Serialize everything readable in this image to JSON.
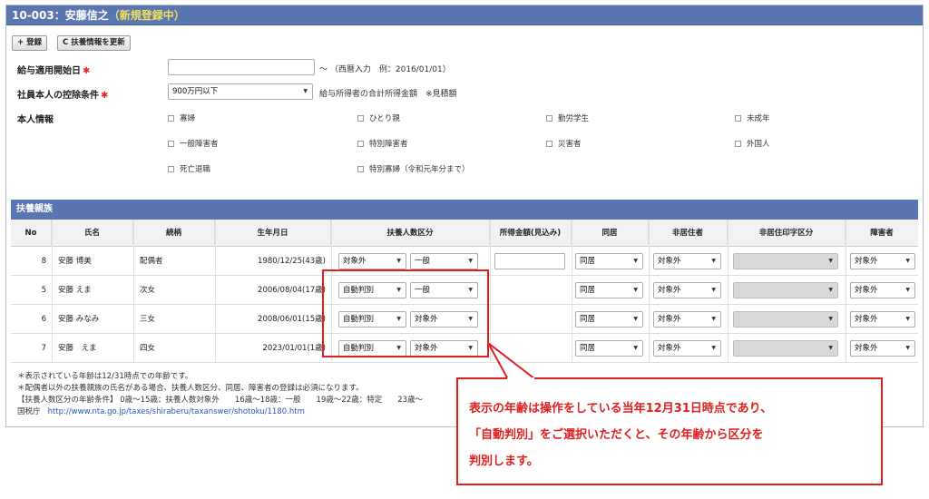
{
  "header": {
    "title": "10-003：安藤信之",
    "status": "（新規登録中）"
  },
  "toolbar": {
    "register_label": "登録",
    "register_icon": "+",
    "refresh_label": "扶養情報を更新",
    "refresh_icon": "C"
  },
  "form": {
    "start_date": {
      "label": "給与適用開始日",
      "required": "✱",
      "value": "",
      "hint": "〜 （西暦入力　例：2016/01/01）"
    },
    "deduction": {
      "label": "社員本人の控除条件",
      "required": "✱",
      "value": "900万円以下",
      "hint": "給与所得者の合計所得金額　※見積額"
    },
    "personal": {
      "label": "本人情報",
      "options": [
        "寡婦",
        "ひとり親",
        "勤労学生",
        "未成年",
        "一般障害者",
        "特別障害者",
        "災害者",
        "外国人",
        "死亡退職",
        "特別寡婦（令和元年分まで）"
      ]
    }
  },
  "dependents": {
    "title": "扶養親族",
    "columns": [
      "No",
      "氏名",
      "続柄",
      "生年月日",
      "扶養人数区分",
      "所得金額(見込み)",
      "同居",
      "非居住者",
      "非居住印字区分",
      "障害者"
    ],
    "rows": [
      {
        "no": "8",
        "name": "安藤 博美",
        "relation": "配偶者",
        "birth": "1980/12/25(43歳)",
        "kubun1": "対象外",
        "kubun2": "一般",
        "dokyo": "同居",
        "hikyo": "対象外",
        "hikyo_print": "",
        "shogai": "対象外"
      },
      {
        "no": "5",
        "name": "安藤 えま",
        "relation": "次女",
        "birth": "2006/08/04(17歳)",
        "kubun1": "自動判別",
        "kubun2": "一般",
        "dokyo": "同居",
        "hikyo": "対象外",
        "hikyo_print": "",
        "shogai": "対象外"
      },
      {
        "no": "6",
        "name": "安藤 みなみ",
        "relation": "三女",
        "birth": "2008/06/01(15歳)",
        "kubun1": "自動判別",
        "kubun2": "対象外",
        "dokyo": "同居",
        "hikyo": "対象外",
        "hikyo_print": "",
        "shogai": "対象外"
      },
      {
        "no": "7",
        "name": "安藤　えま",
        "relation": "四女",
        "birth": "2023/01/01(1歳)",
        "kubun1": "自動判別",
        "kubun2": "対象外",
        "dokyo": "同居",
        "hikyo": "対象外",
        "hikyo_print": "",
        "shogai": "対象外"
      }
    ]
  },
  "notes": {
    "line1": "＊表示されている年齢は12/31時点での年齢です。",
    "line2": "＊配偶者以外の扶養親族の氏名がある場合、扶養人数区分、同居、障害者の登録は必須になります。",
    "line3": "【扶養人数区分の年齢条件】 0歳〜15歳：扶養人数対象外　　16歳〜18歳：一般　　19歳〜22歳：特定　　23歳〜",
    "line4_prefix": "国税庁",
    "line4_link": "http://www.nta.go.jp/taxes/shiraberu/taxanswer/shotoku/1180.htm"
  },
  "callout": {
    "line1": "表示の年齢は操作をしている当年12月31日時点であり、",
    "line2": "「自動判別」をご選択いただくと、その年齢から区分を",
    "line3": "判別します。"
  },
  "colors": {
    "header_bg": "#5a76b0",
    "status_text": "#f0e05a",
    "required": "#e22222",
    "callout": "#e02020",
    "link": "#2a55b5"
  }
}
